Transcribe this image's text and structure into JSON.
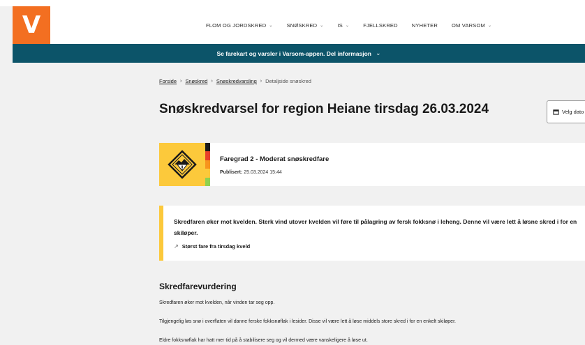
{
  "brand": {
    "logo_letter": "V",
    "logo_color": "#f36f21"
  },
  "nav": {
    "items": [
      {
        "label": "FLOM OG JORDSKRED",
        "has_dropdown": true
      },
      {
        "label": "SNØSKRED",
        "has_dropdown": true
      },
      {
        "label": "IS",
        "has_dropdown": true
      },
      {
        "label": "FJELLSKRED",
        "has_dropdown": false
      },
      {
        "label": "NYHETER",
        "has_dropdown": false
      },
      {
        "label": "OM VARSOM",
        "has_dropdown": true
      }
    ]
  },
  "banner": {
    "text": "Se farekart og varsler i Varsom-appen. Del informasjon",
    "color": "#0c5469"
  },
  "breadcrumb": {
    "items": [
      "Forside",
      "Snøskred",
      "Snøskredvarsling"
    ],
    "current": "Detaljside snøskred"
  },
  "page": {
    "title": "Snøskredvarsel for region Heiane tirsdag 26.03.2024",
    "date_button": "Velg dato"
  },
  "danger": {
    "level_title": "Faregrad 2 - Moderat snøskredfare",
    "published_label": "Publisert:",
    "published_value": "25.03.2024 15:44",
    "icon": "avalanche-danger-level-2-icon",
    "level_color": "#fcc93b",
    "scale_colors": [
      "#1a1a1a",
      "#e8402a",
      "#f7941d",
      "#fcc93b",
      "#8fd14f"
    ]
  },
  "summary": {
    "text": "Skredfaren øker mot kvelden. Sterk vind utover kvelden vil føre til pålagring av fersk fokksnø i leheng. Denne vil være lett å løsne skred i for en skiløper.",
    "trend_icon": "trend-up-icon",
    "trend_label": "Størst fare fra tirsdag kveld"
  },
  "assessment": {
    "heading": "Skredfarevurdering",
    "paragraphs": [
      "Skredfaren øker mot kvelden, når vinden tar seg opp.",
      "Tilgjengelig løs snø i overflaten vil danne ferske fokksnøflak i lesider. Disse vil være lett å løse middels store skred i for en enkelt skiløper.",
      "Eldre fokksnøflak har hatt mer tid på å stabilisere seg og vil dermed være vanskeligere å løse ut."
    ]
  }
}
